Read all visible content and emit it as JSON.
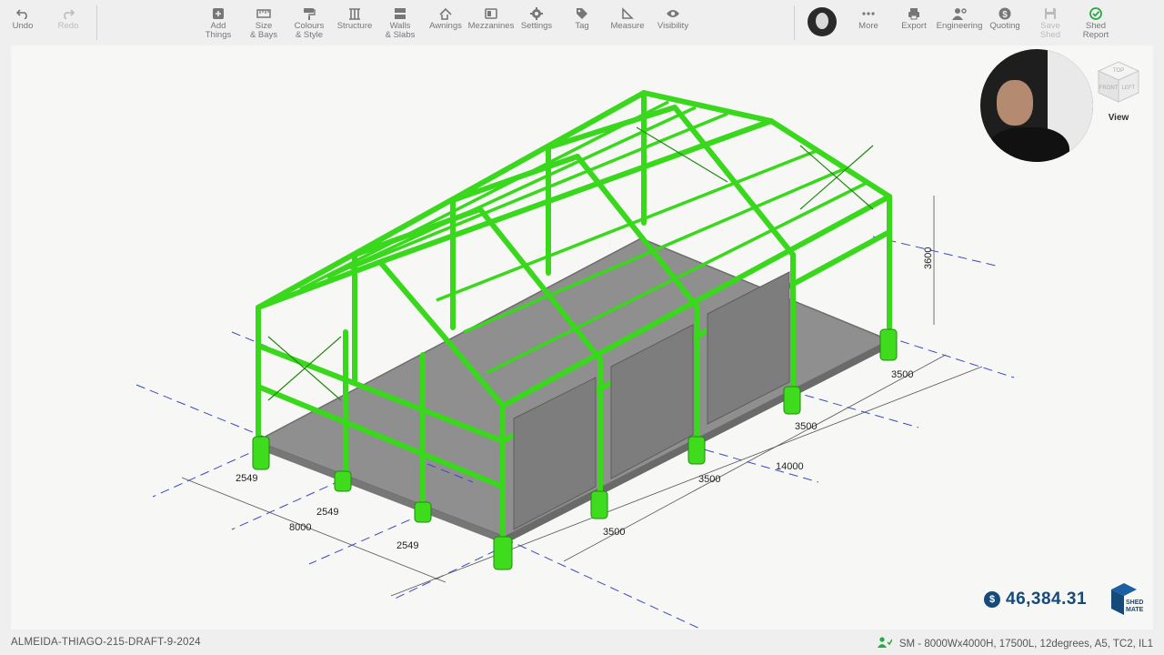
{
  "toolbar": {
    "left": [
      {
        "label": "Undo",
        "icon": "undo-icon"
      },
      {
        "label": "Redo",
        "icon": "redo-icon",
        "disabled": true
      }
    ],
    "center": [
      {
        "label": "Add\nThings",
        "icon": "add-things-icon"
      },
      {
        "label": "Size\n& Bays",
        "icon": "ruler-icon"
      },
      {
        "label": "Colours\n& Style",
        "icon": "paint-roller-icon"
      },
      {
        "label": "Structure",
        "icon": "structure-icon"
      },
      {
        "label": "Walls\n& Slabs",
        "icon": "walls-icon"
      },
      {
        "label": "Awnings",
        "icon": "awning-icon"
      },
      {
        "label": "Mezzanines",
        "icon": "mezzanine-icon"
      },
      {
        "label": "Settings",
        "icon": "gear-icon"
      },
      {
        "label": "Tag",
        "icon": "tag-icon"
      },
      {
        "label": "Measure",
        "icon": "measure-icon"
      },
      {
        "label": "Visibility",
        "icon": "eye-icon"
      }
    ],
    "right": [
      {
        "label": "More",
        "icon": "more-icon"
      },
      {
        "label": "Export",
        "icon": "printer-icon"
      },
      {
        "label": "Engineering",
        "icon": "engineer-icon"
      },
      {
        "label": "Quoting",
        "icon": "dollar-icon"
      },
      {
        "label": "Save\nShed",
        "icon": "save-icon",
        "disabled": true
      },
      {
        "label": "Shed\nReport",
        "icon": "check-circle-icon"
      }
    ]
  },
  "viewcube": {
    "faces": [
      "TOP",
      "FRONT",
      "LEFT"
    ],
    "label": "View"
  },
  "dimensions": {
    "height": "3600",
    "side_total": "14000",
    "side_bays": [
      "3500",
      "3500",
      "3500",
      "3500"
    ],
    "front_total": "8000",
    "front_bays": [
      "2549",
      "2549",
      "2549"
    ]
  },
  "price": {
    "symbol": "$",
    "amount": "46,384.31"
  },
  "logo": {
    "text_top": "SHED",
    "text_bottom": "MATE"
  },
  "status": {
    "document_name": "ALMEIDA-THIAGO-215-DRAFT-9-2024",
    "spec": "SM - 8000Wx4000H, 17500L, 12degrees, A5, TC2, IL1"
  },
  "colors": {
    "steel": "#3fdc1e",
    "steel_dark": "#1f8a0e",
    "slab": "#8e8e8e",
    "brand": "#164a7a",
    "dim_line": "#3a48c8"
  }
}
